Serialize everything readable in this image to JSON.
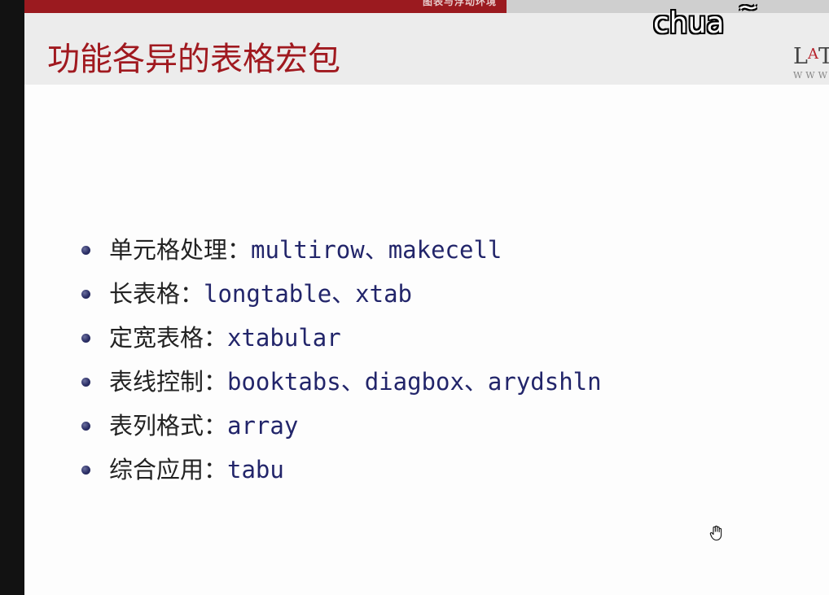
{
  "header": {
    "section_label": "图表与浮动环境"
  },
  "slide": {
    "title": "功能各异的表格宏包",
    "logo_text_a": "L",
    "logo_text_accent": "A",
    "logo_text_b": "T",
    "logo_sub": "WWW"
  },
  "bullets": [
    {
      "label": "单元格处理：",
      "packages": "multirow、makecell"
    },
    {
      "label": "长表格：",
      "packages": "longtable、xtab"
    },
    {
      "label": "定宽表格：",
      "packages": "xtabular"
    },
    {
      "label": "表线控制：",
      "packages": "booktabs、diagbox、arydshln"
    },
    {
      "label": "表列格式：",
      "packages": "array"
    },
    {
      "label": "综合应用：",
      "packages": "tabu"
    }
  ],
  "overlay": {
    "watermark": "chua",
    "watermark_tilde": "~"
  },
  "icons": {
    "cursor": "hand-cursor-icon",
    "bullet": "bullet-dot-icon"
  },
  "colors": {
    "accent_red": "#9b1a1f",
    "bullet_navy": "#22256a",
    "title_red": "#a0191f"
  }
}
